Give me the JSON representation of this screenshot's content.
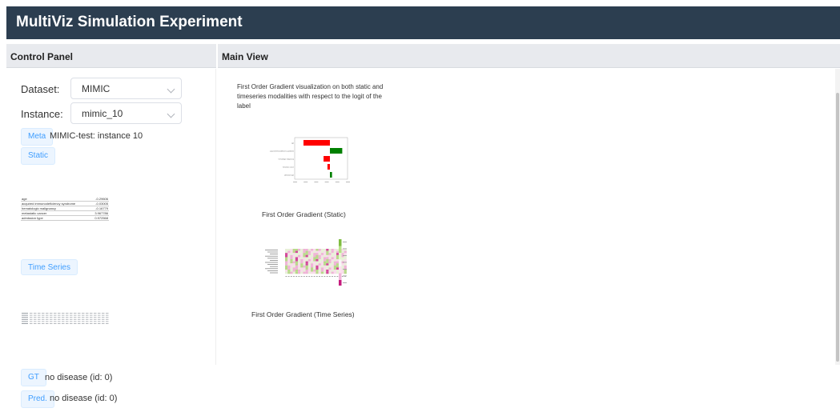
{
  "app": {
    "title": "MultiViz Simulation Experiment"
  },
  "control_panel": {
    "title": "Control Panel",
    "dataset": {
      "label": "Dataset:",
      "value": "MIMIC"
    },
    "instance": {
      "label": "Instance:",
      "value": "mimic_10"
    },
    "meta": {
      "button": "Meta",
      "text": "MIMIC-test: instance 10"
    },
    "static": {
      "button": "Static",
      "rows": [
        {
          "feature": "age",
          "value": "-0.29606"
        },
        {
          "feature": "acquired immunodeficiency syndrome",
          "value": "-0.03005"
        },
        {
          "feature": "hematologic malignancy",
          "value": "-0.16779"
        },
        {
          "feature": "metastatic cancer",
          "value": "3.967786"
        },
        {
          "feature": "admission type",
          "value": "0.972568"
        }
      ]
    },
    "time_series": {
      "button": "Time Series"
    },
    "gt": {
      "button": "GT",
      "text": "no disease (id: 0)"
    },
    "pred": {
      "button": "Pred.",
      "text": "no disease (id: 0)"
    }
  },
  "main_view": {
    "title": "Main View",
    "description": "First Order Gradient visualization on both static and timeseries modalities with respect to the logit of the label",
    "static_caption": "First Order Gradient (Static)",
    "timeseries_caption": "First Order Gradient (Time Series)",
    "static_chart": {
      "features": [
        "age",
        "acquired immunodeficiency syndrome",
        "hematologic malignancy",
        "metastatic cancer",
        "admission type"
      ],
      "values": [
        -0.075,
        0.035,
        -0.018,
        -0.007,
        0.006
      ],
      "colors": {
        "positive": "#008000",
        "negative": "#ff0000"
      }
    },
    "heatmap_colors": {
      "positive": "#7fbc41",
      "negative": "#c51b7d",
      "neutral": "#f7f7f7"
    }
  }
}
